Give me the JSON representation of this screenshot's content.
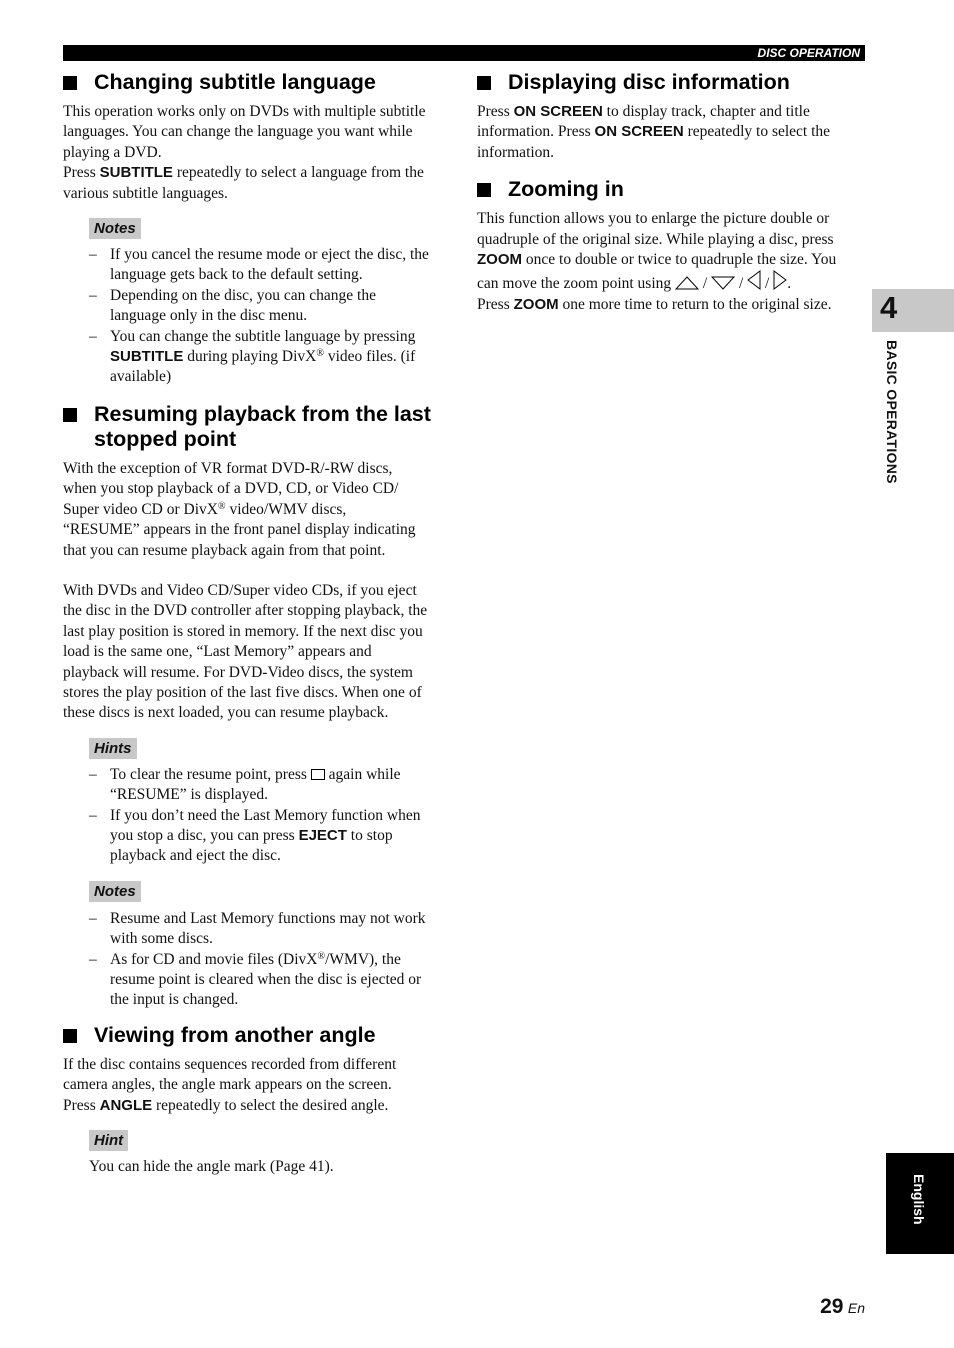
{
  "header": {
    "section_title": "DISC OPERATION"
  },
  "chapter": {
    "number": "4",
    "label": "BASIC OPERATIONS"
  },
  "language_tab": "English",
  "page": {
    "number": "29",
    "suffix": "En"
  },
  "sections": {
    "subtitle": {
      "title": "Changing subtitle language",
      "body_lines": [
        "This operation works only on DVDs with multiple subtitle",
        "languages. You can change the language you want while",
        "playing a DVD."
      ],
      "press_prefix": "Press ",
      "press_key": "SUBTITLE",
      "press_suffix_line1": " repeatedly to select a language from the",
      "press_line2": "various subtitle languages.",
      "notes_label": "Notes",
      "notes": [
        [
          "If you cancel the resume mode or eject the disc, the",
          "language gets back to the default setting."
        ],
        [
          "Depending on the disc, you can change the",
          "language only in the disc menu."
        ]
      ],
      "note3_line1": "You can change the subtitle language by pressing",
      "note3_key": "SUBTITLE",
      "note3_mid": " during playing DivX",
      "reg": "®",
      "note3_end": " video files. (if",
      "note3_line3": "available)"
    },
    "resume": {
      "title_line1": "Resuming playback from the last",
      "title_line2": "stopped point",
      "para1": [
        "With the exception of VR format DVD-R/-RW discs,",
        "when you stop playback of a DVD, CD, or Video CD/"
      ],
      "para1_l3_a": "Super video CD or DivX",
      "para1_l3_b": " video/WMV discs,",
      "para1_rest": [
        "“RESUME” appears in the front panel display indicating",
        "that you can resume playback again from that point."
      ],
      "para2": [
        "With DVDs and Video CD/Super video CDs, if you eject",
        "the disc in the DVD controller after stopping playback, the",
        "last play position is stored in memory. If the next disc you",
        "load is the same one, “Last Memory” appears and",
        "playback will resume. For DVD-Video discs, the system",
        "stores the play position of the last five discs. When one of",
        "these discs is next loaded, you can resume playback."
      ],
      "hints_label": "Hints",
      "hint1_a": "To clear the resume point, press ",
      "hint1_icon": "stop-icon",
      "hint1_b": " again while",
      "hint1_line2": "“RESUME” is displayed.",
      "hint2_line1": "If you don’t need the Last Memory function when",
      "hint2_a": "you stop a disc, you can press ",
      "hint2_key": "EJECT",
      "hint2_b": " to stop",
      "hint2_line3": "playback and eject the disc.",
      "notes_label": "Notes",
      "note1": [
        "Resume and Last Memory functions may not work",
        "with some discs."
      ],
      "note2_a": "As for CD and movie files (DivX",
      "note2_b": "/WMV), the",
      "note2_rest": [
        "resume point is cleared when the disc is ejected or",
        "the input is changed."
      ]
    },
    "angle": {
      "title": "Viewing from another angle",
      "body_lines": [
        "If the disc contains sequences recorded from different",
        "camera angles, the angle mark appears on the screen."
      ],
      "press_prefix": "Press ",
      "press_key": "ANGLE",
      "press_suffix": " repeatedly to select the desired angle.",
      "hint_label": "Hint",
      "hint_text": "You can hide the angle mark (Page 41)."
    },
    "disc_info": {
      "title": "Displaying disc information",
      "l1_a": "Press ",
      "key": "ON SCREEN",
      "l1_b": " to display track, chapter and title",
      "l2_a": "information. Press ",
      "l2_b": " repeatedly to select the",
      "l3": "information."
    },
    "zoom": {
      "title": "Zooming in",
      "lines": [
        "This function allows you to enlarge the picture double or",
        "quadruple of the original size. While playing a disc, press"
      ],
      "key": "ZOOM",
      "l3_b": " once to double or twice to quadruple the size. You",
      "l4": "can move the zoom point using ",
      "sep": " / ",
      "arrows": [
        "up-arrow-icon",
        "down-arrow-icon",
        "left-arrow-icon",
        "right-arrow-icon"
      ],
      "l4_end": ".",
      "l5_a": "Press ",
      "l5_b": " one more time to return to the original size."
    }
  }
}
